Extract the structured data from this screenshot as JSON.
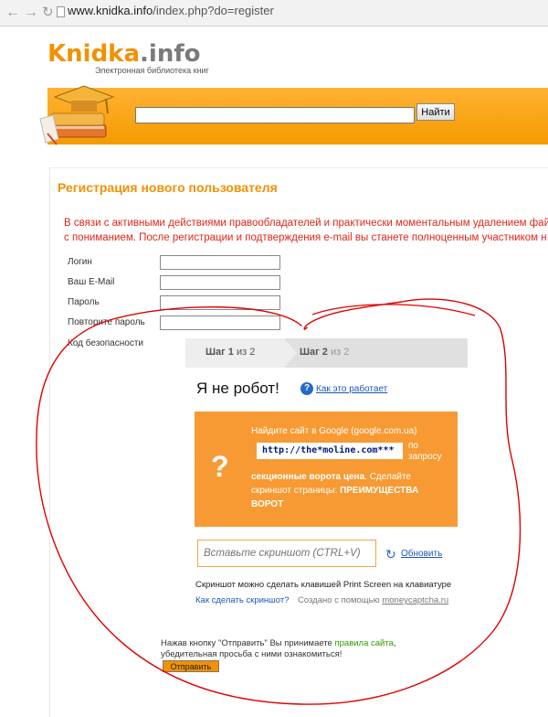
{
  "browser": {
    "url_host": "www.knidka.info",
    "url_path": "/index.php?do=register"
  },
  "header": {
    "logo_part1": "Knidka",
    "logo_part2": ".info",
    "tagline": "Электронная библиотека книг",
    "search_placeholder": "",
    "search_button": "Найти"
  },
  "registration": {
    "title": "Регистрация нового пользователя",
    "notice_line1": "В связи с активными действиями правообладателей и практически моментальным удалением фай",
    "notice_line2": "с пониманием. После регистрации и подтверждения e-mail вы станете полноценным участником н",
    "fields": {
      "login": "Логин",
      "email": "Ваш E-Mail",
      "password": "Пароль",
      "repeat_password": "Повторите пароль",
      "security_code": "Код безопасности"
    }
  },
  "captcha": {
    "step1": "Шаг 1",
    "step1_of": "из 2",
    "step2": "Шаг 2",
    "step2_of": "из 2",
    "not_robot": "Я не робот!",
    "how_it_works": "Как это работает",
    "task_line1": "Найдите сайт в Google (google.com.ua)",
    "query": "http://the*moline.com***",
    "query_after": "по запросу",
    "task_bold1": "секционные ворота цена",
    "task_mid": ". Сделайте скриншот страницы:",
    "task_bold2": "ПРЕИМУЩЕСТВА ВОРОТ",
    "screenshot_placeholder": "Вставьте скриншот (CTRL+V)",
    "refresh": "Обновить",
    "hint": "Скриншот можно сделать клавишей Print Screen на клавиатуре",
    "how_to": "Как сделать скриншот?",
    "made_with": "Создано с помощью",
    "made_with_link": "moneycaptcha.ru"
  },
  "terms": {
    "prefix": "Нажав кнопку \"Отправить\" Вы принимаете",
    "link": "правила сайта",
    "suffix": ",",
    "line2": "убедительная просьба с ними ознакомиться!",
    "submit": "Отправить"
  },
  "colors": {
    "accent": "#f29100",
    "notice": "#e0261a",
    "link": "#1a57b8",
    "captcha_bg": "#f79a33",
    "scribble": "#e00000"
  },
  "icons": {
    "back": "arrow-left-icon",
    "forward": "arrow-right-icon",
    "reload": "reload-icon",
    "page": "page-icon",
    "help": "question-circle-icon",
    "refresh": "refresh-icon",
    "logo_image": "books-graduation-cap-icon"
  }
}
